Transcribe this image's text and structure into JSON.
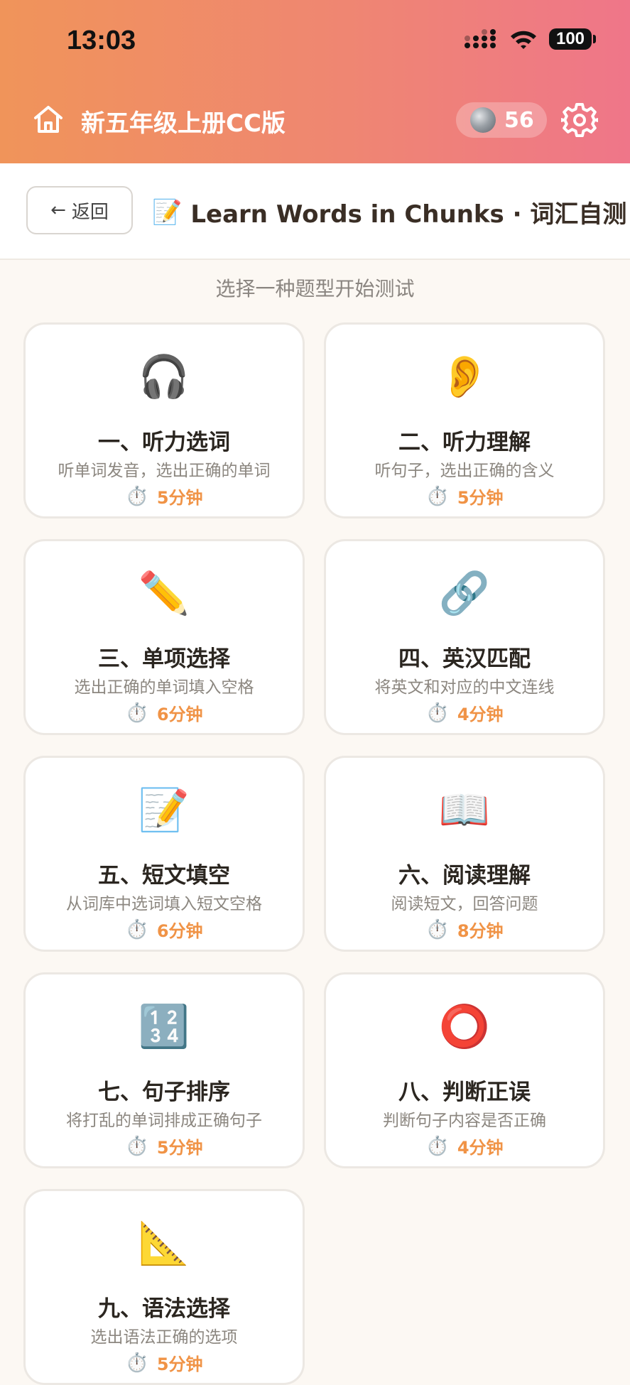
{
  "status": {
    "time": "13:03",
    "battery": "100"
  },
  "header": {
    "title": "新五年级上册CC版",
    "coins": "56"
  },
  "subheader": {
    "back_label": "返回",
    "title_icon": "📝",
    "title": "Learn Words in Chunks · 词汇自测"
  },
  "hint": "选择一种题型开始测试",
  "cards": [
    {
      "icon": "🎧",
      "title": "一、听力选词",
      "desc": "听单词发音，选出正确的单词",
      "time": "5分钟"
    },
    {
      "icon": "👂",
      "title": "二、听力理解",
      "desc": "听句子，选出正确的含义",
      "time": "5分钟"
    },
    {
      "icon": "✏️",
      "title": "三、单项选择",
      "desc": "选出正确的单词填入空格",
      "time": "6分钟"
    },
    {
      "icon": "🔗",
      "title": "四、英汉匹配",
      "desc": "将英文和对应的中文连线",
      "time": "4分钟"
    },
    {
      "icon": "📝",
      "title": "五、短文填空",
      "desc": "从词库中选词填入短文空格",
      "time": "6分钟"
    },
    {
      "icon": "📖",
      "title": "六、阅读理解",
      "desc": "阅读短文，回答问题",
      "time": "8分钟"
    },
    {
      "icon": "🔢",
      "title": "七、句子排序",
      "desc": "将打乱的单词排成正确句子",
      "time": "5分钟"
    },
    {
      "icon": "⭕",
      "title": "八、判断正误",
      "desc": "判断句子内容是否正确",
      "time": "4分钟"
    },
    {
      "icon": "📐",
      "title": "九、语法选择",
      "desc": "选出语法正确的选项",
      "time": "5分钟"
    }
  ],
  "timer_icon": "⏱️",
  "colors": {
    "accent": "#f09346",
    "header_start": "#f0945a",
    "header_end": "#ef7689"
  }
}
